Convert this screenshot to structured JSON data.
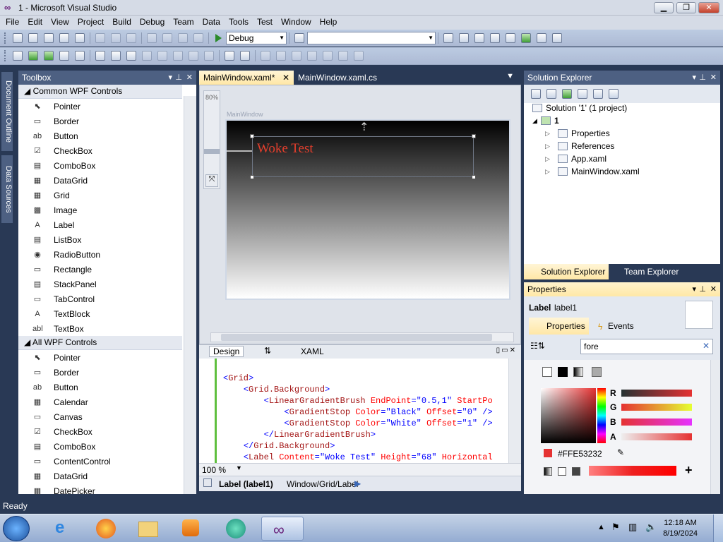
{
  "window": {
    "title": "1 - Microsoft Visual Studio",
    "min_label": "▁",
    "max_label": "❐",
    "close_label": "✕"
  },
  "menu": [
    "File",
    "Edit",
    "View",
    "Project",
    "Build",
    "Debug",
    "Team",
    "Data",
    "Tools",
    "Test",
    "Window",
    "Help"
  ],
  "toolbar": {
    "config_value": "Debug",
    "search_value": ""
  },
  "sidebar": {
    "tab1": "Document Outline",
    "tab2": "Data Sources"
  },
  "toolbox": {
    "title": "Toolbox",
    "group1": "Common WPF Controls",
    "group1_items": [
      {
        "label": "Pointer",
        "icon": "pointer-icon",
        "glyph": "⬉"
      },
      {
        "label": "Border",
        "icon": "border-icon",
        "glyph": "▭"
      },
      {
        "label": "Button",
        "icon": "button-icon",
        "glyph": "ab"
      },
      {
        "label": "CheckBox",
        "icon": "checkbox-icon",
        "glyph": "☑"
      },
      {
        "label": "ComboBox",
        "icon": "combobox-icon",
        "glyph": "▤"
      },
      {
        "label": "DataGrid",
        "icon": "datagrid-icon",
        "glyph": "▦"
      },
      {
        "label": "Grid",
        "icon": "grid-icon",
        "glyph": "▦"
      },
      {
        "label": "Image",
        "icon": "image-icon",
        "glyph": "▩"
      },
      {
        "label": "Label",
        "icon": "label-icon",
        "glyph": "A"
      },
      {
        "label": "ListBox",
        "icon": "listbox-icon",
        "glyph": "▤"
      },
      {
        "label": "RadioButton",
        "icon": "radiobutton-icon",
        "glyph": "◉"
      },
      {
        "label": "Rectangle",
        "icon": "rectangle-icon",
        "glyph": "▭"
      },
      {
        "label": "StackPanel",
        "icon": "stackpanel-icon",
        "glyph": "▤"
      },
      {
        "label": "TabControl",
        "icon": "tabcontrol-icon",
        "glyph": "▭"
      },
      {
        "label": "TextBlock",
        "icon": "textblock-icon",
        "glyph": "A"
      },
      {
        "label": "TextBox",
        "icon": "textbox-icon",
        "glyph": "abl"
      }
    ],
    "group2": "All WPF Controls",
    "group2_items": [
      {
        "label": "Pointer",
        "icon": "pointer-icon",
        "glyph": "⬉"
      },
      {
        "label": "Border",
        "icon": "border-icon",
        "glyph": "▭"
      },
      {
        "label": "Button",
        "icon": "button-icon",
        "glyph": "ab"
      },
      {
        "label": "Calendar",
        "icon": "calendar-icon",
        "glyph": "▦"
      },
      {
        "label": "Canvas",
        "icon": "canvas-icon",
        "glyph": "▭"
      },
      {
        "label": "CheckBox",
        "icon": "checkbox-icon",
        "glyph": "☑"
      },
      {
        "label": "ComboBox",
        "icon": "combobox-icon",
        "glyph": "▤"
      },
      {
        "label": "ContentControl",
        "icon": "contentcontrol-icon",
        "glyph": "▭"
      },
      {
        "label": "DataGrid",
        "icon": "datagrid-icon",
        "glyph": "▦"
      },
      {
        "label": "DatePicker",
        "icon": "datepicker-icon",
        "glyph": "▦"
      }
    ]
  },
  "doc_tabs": {
    "active": "MainWindow.xaml*",
    "other": "MainWindow.xaml.cs"
  },
  "designer": {
    "zoom": "80%",
    "window_title": "MainWindow",
    "label_text": "Woke Test"
  },
  "split": {
    "design": "Design",
    "swap": "⇅",
    "xaml": "XAML"
  },
  "xaml_lines": [
    {
      "indent": "",
      "parts": [
        [
          "b",
          "<"
        ],
        [
          "m",
          "Grid"
        ],
        [
          "b",
          ">"
        ]
      ]
    },
    {
      "indent": "    ",
      "parts": [
        [
          "b",
          "<"
        ],
        [
          "m",
          "Grid.Background"
        ],
        [
          "b",
          ">"
        ]
      ]
    },
    {
      "indent": "        ",
      "parts": [
        [
          "b",
          "<"
        ],
        [
          "m",
          "LinearGradientBrush"
        ],
        [
          "r",
          " EndPoint"
        ],
        [
          "b",
          "=\"0.5,1\""
        ],
        [
          "r",
          " StartPo"
        ]
      ]
    },
    {
      "indent": "            ",
      "parts": [
        [
          "b",
          "<"
        ],
        [
          "m",
          "GradientStop"
        ],
        [
          "r",
          " Color"
        ],
        [
          "b",
          "=\"Black\""
        ],
        [
          "r",
          " Offset"
        ],
        [
          "b",
          "=\"0\" />"
        ]
      ]
    },
    {
      "indent": "            ",
      "parts": [
        [
          "b",
          "<"
        ],
        [
          "m",
          "GradientStop"
        ],
        [
          "r",
          " Color"
        ],
        [
          "b",
          "=\"White\""
        ],
        [
          "r",
          " Offset"
        ],
        [
          "b",
          "=\"1\" />"
        ]
      ]
    },
    {
      "indent": "        ",
      "parts": [
        [
          "b",
          "</"
        ],
        [
          "m",
          "LinearGradientBrush"
        ],
        [
          "b",
          ">"
        ]
      ]
    },
    {
      "indent": "    ",
      "parts": [
        [
          "b",
          "</"
        ],
        [
          "m",
          "Grid.Background"
        ],
        [
          "b",
          ">"
        ]
      ]
    },
    {
      "indent": "    ",
      "parts": [
        [
          "b",
          "<"
        ],
        [
          "m",
          "Label"
        ],
        [
          "r",
          " Content"
        ],
        [
          "b",
          "=\"Woke Test\""
        ],
        [
          "r",
          " Height"
        ],
        [
          "b",
          "=\"68\""
        ],
        [
          "r",
          " Horizontal"
        ]
      ]
    }
  ],
  "xaml_status": {
    "zoom": "100 %"
  },
  "breadcrumb": {
    "element": "Label (label1)",
    "path": "Window/Grid/Label"
  },
  "solution_explorer": {
    "title": "Solution Explorer",
    "solution": "Solution '1' (1 project)",
    "project": "1",
    "items": [
      "Properties",
      "References",
      "App.xaml",
      "MainWindow.xaml"
    ],
    "tab1": "Solution Explorer",
    "tab2": "Team Explorer"
  },
  "properties": {
    "title": "Properties",
    "type": "Label",
    "name": "label1",
    "tab_props": "Properties",
    "tab_events": "Events",
    "search": "fore",
    "channels": [
      "R",
      "G",
      "B",
      "A"
    ],
    "hex": "#FFE53232"
  },
  "status": {
    "text": "Ready"
  },
  "taskbar": {
    "time": "12:18 AM",
    "date": "8/19/2024"
  },
  "colors": {
    "accent": "#e53232",
    "chrome": "#293955",
    "panel_header": "#4d6082"
  }
}
